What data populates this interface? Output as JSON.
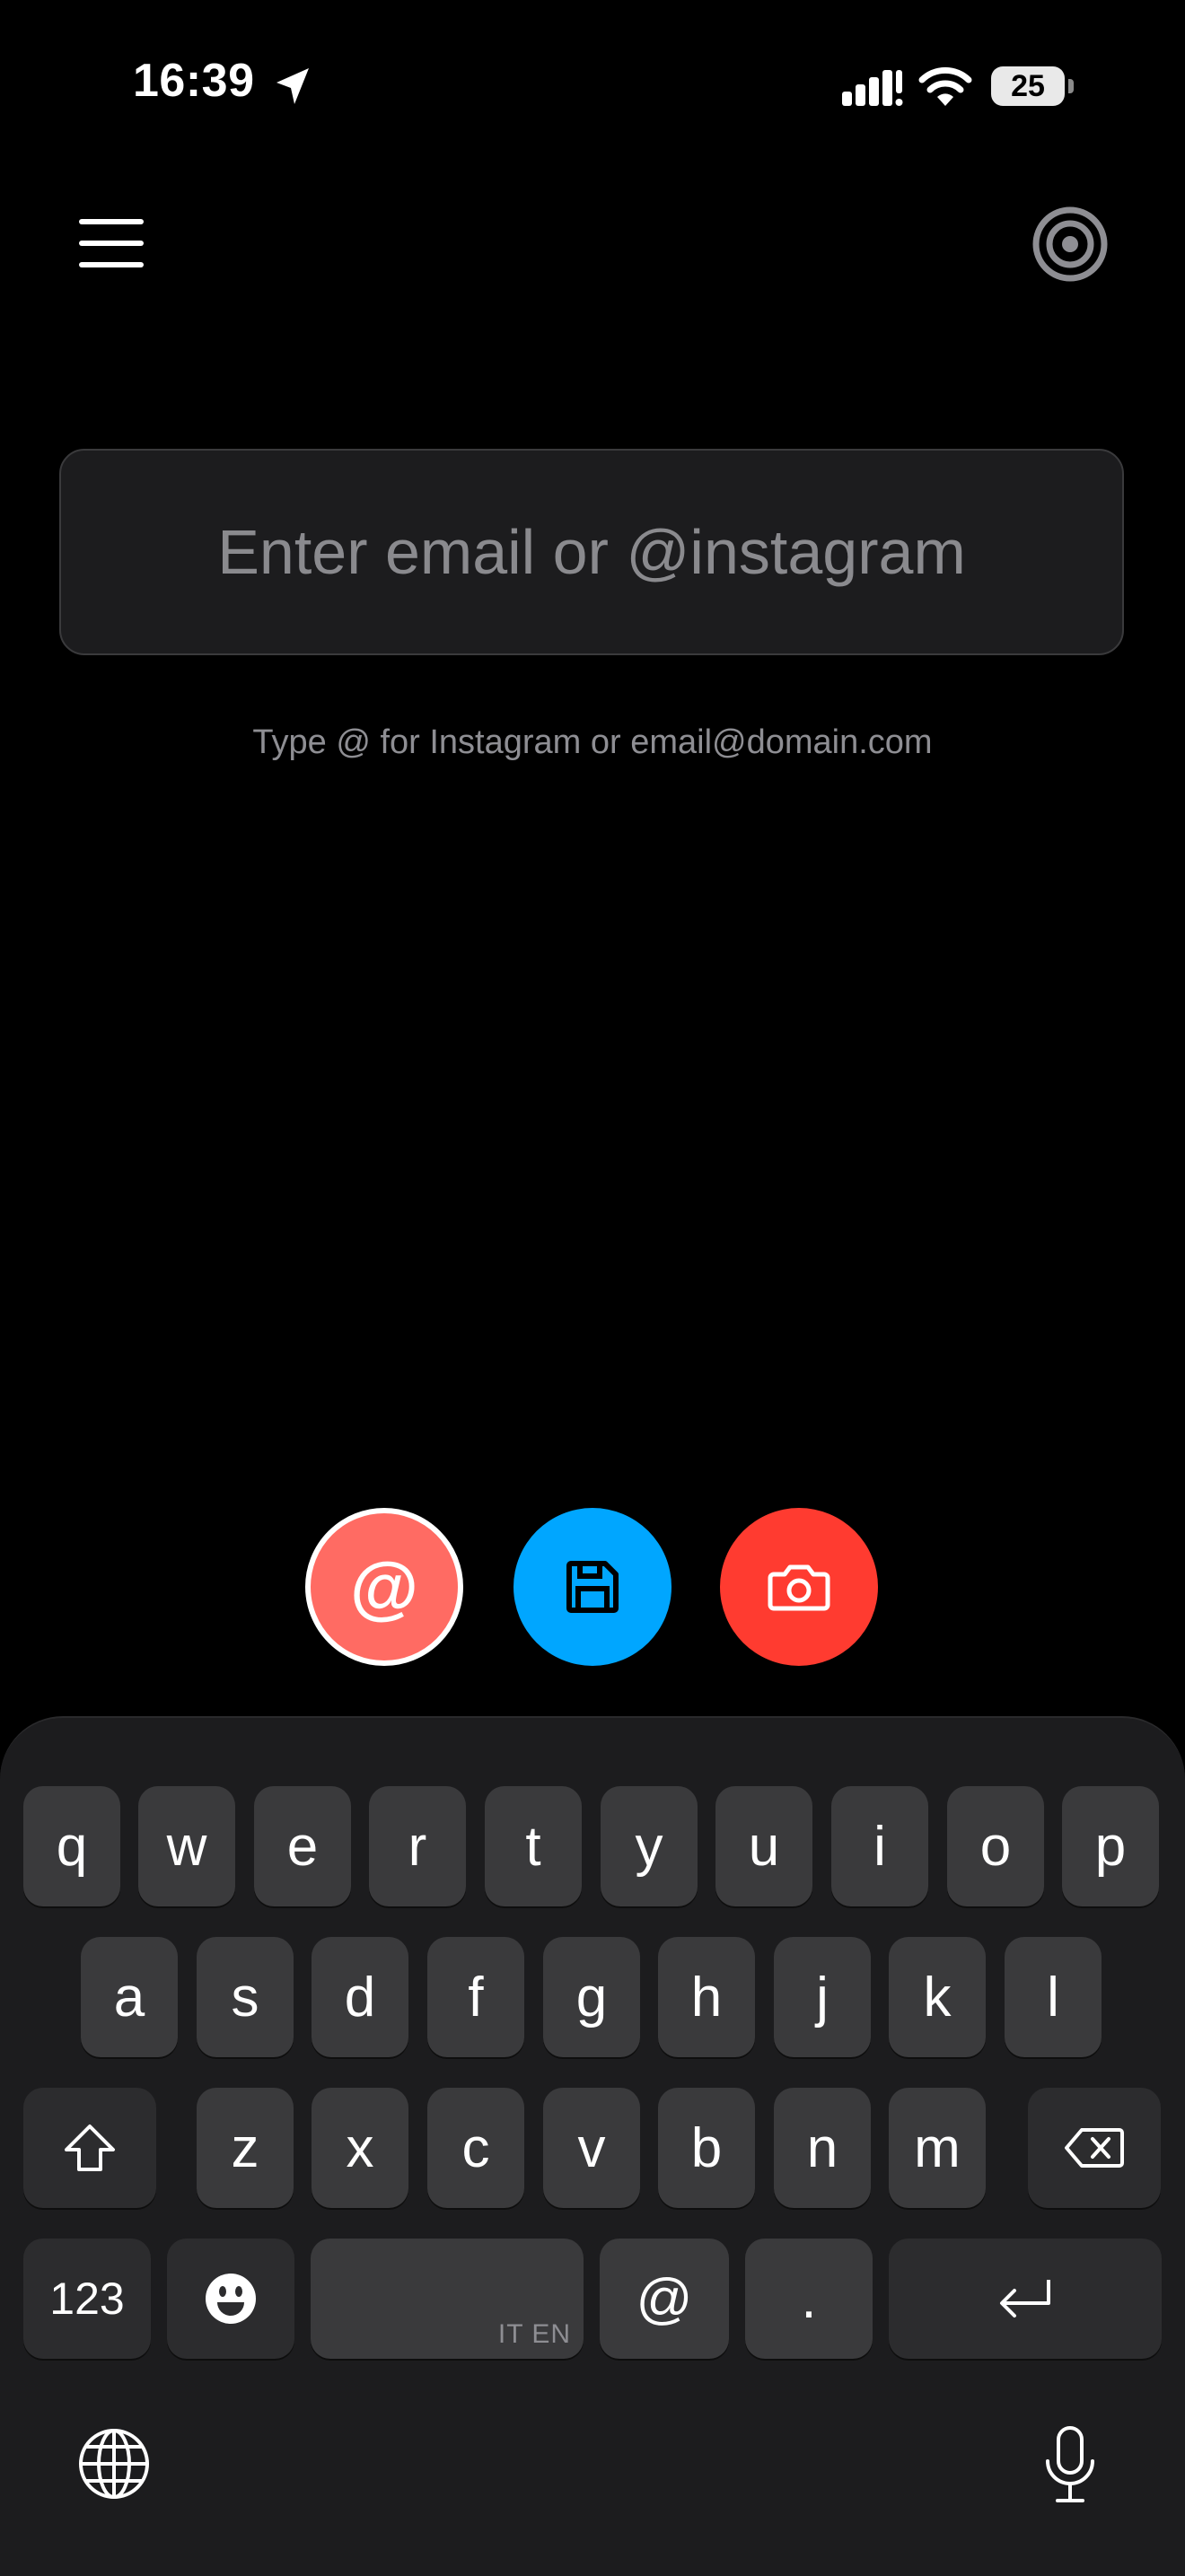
{
  "status_bar": {
    "time": "16:39",
    "battery": "25"
  },
  "header": {
    "menu_icon": "hamburger-menu-icon",
    "right_icon": "target-icon"
  },
  "input": {
    "placeholder": "Enter email or @instagram",
    "value": ""
  },
  "hint": "Type @ for Instagram or email@domain.com",
  "actions": {
    "at_label": "@",
    "save_icon": "floppy-disk-icon",
    "camera_icon": "camera-icon"
  },
  "colors": {
    "at_button": "#ff6b63",
    "save_button": "#00a6ff",
    "camera_button": "#ff3b30"
  },
  "keyboard": {
    "row1": [
      "q",
      "w",
      "e",
      "r",
      "t",
      "y",
      "u",
      "i",
      "o",
      "p"
    ],
    "row2": [
      "a",
      "s",
      "d",
      "f",
      "g",
      "h",
      "j",
      "k",
      "l"
    ],
    "row3": [
      "z",
      "x",
      "c",
      "v",
      "b",
      "n",
      "m"
    ],
    "numbers_label": "123",
    "space_languages": "IT EN",
    "at_key": "@",
    "dot_key": "."
  }
}
